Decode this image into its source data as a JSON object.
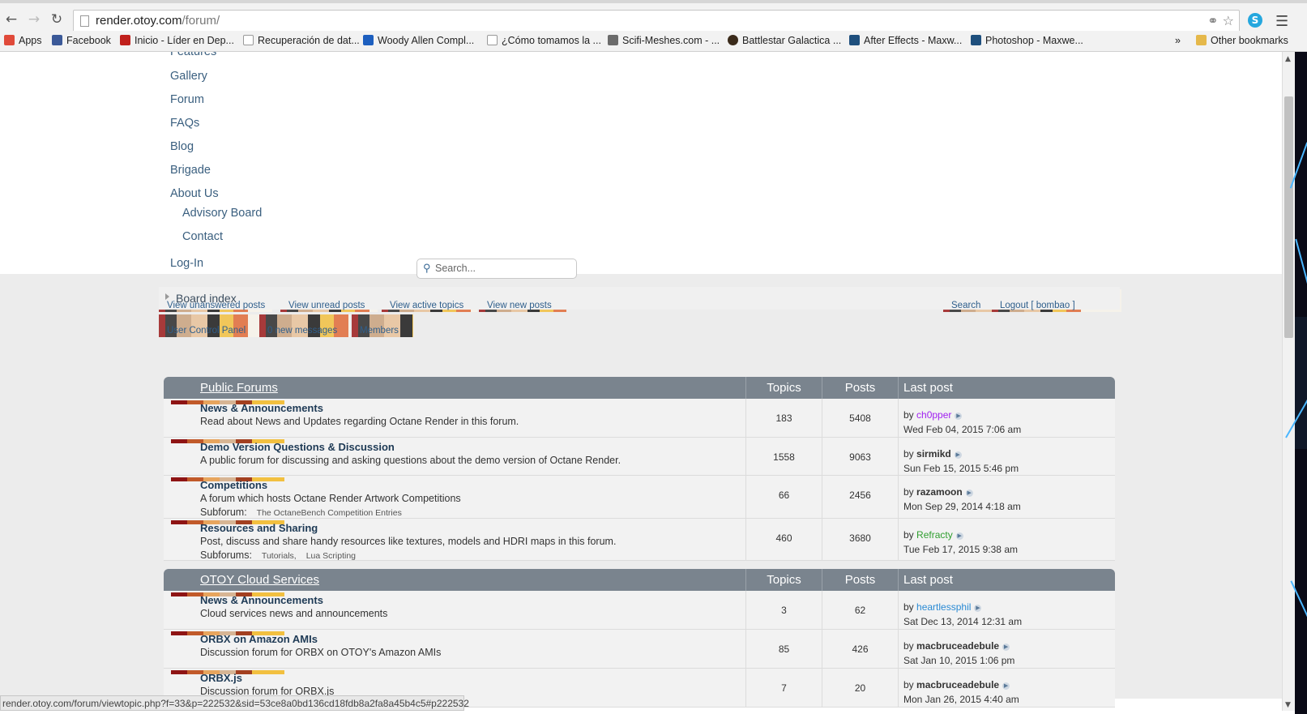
{
  "browser": {
    "url_host": "render.otoy.com",
    "url_path": "/forum/",
    "ext_icon": "S"
  },
  "bookmarks": [
    {
      "label": "Apps",
      "color": "#e04a3a"
    },
    {
      "label": "Facebook",
      "color": "#3b5998"
    },
    {
      "label": "Inicio - Líder en Dep...",
      "color": "#c0201c"
    },
    {
      "label": "Recuperación de dat...",
      "color": "#ffffff"
    },
    {
      "label": "Woody Allen Compl...",
      "color": "#1d5fbf"
    },
    {
      "label": "¿Cómo tomamos la ...",
      "color": "#ffffff"
    },
    {
      "label": "Scifi-Meshes.com - ...",
      "color": "#6b6b6b"
    },
    {
      "label": "Battlestar Galactica ...",
      "color": "#3a2a1a"
    },
    {
      "label": "After Effects - Maxw...",
      "color": "#1e4f7d"
    },
    {
      "label": "Photoshop - Maxwe...",
      "color": "#1e4f7d"
    },
    {
      "label": "»",
      "color": ""
    },
    {
      "label": "Other bookmarks",
      "color": "#e5b84a"
    }
  ],
  "site_menu": [
    {
      "label": "Features"
    },
    {
      "label": "Gallery"
    },
    {
      "label": "Forum"
    },
    {
      "label": "FAQs"
    },
    {
      "label": "Blog"
    },
    {
      "label": "Brigade"
    },
    {
      "label": "About Us"
    },
    {
      "label": "Advisory Board"
    },
    {
      "label": "Contact"
    },
    {
      "label": "Log-In"
    }
  ],
  "actions": {
    "unanswered": "View unanswered posts",
    "unread": "View unread posts",
    "active": "View active topics",
    "new": "View new posts",
    "search": "Search",
    "logout": "Logout [ bombao ]",
    "ucp": "User Control Panel",
    "messages": "0 new messages",
    "members": "Members",
    "search_placeholder": "Search..."
  },
  "breadcrumb": "Board index",
  "categories": [
    {
      "title": "Public Forums",
      "col_topics": "Topics",
      "col_posts": "Posts",
      "col_last": "Last post",
      "forums": [
        {
          "name": "News & Announcements",
          "desc": "Read about News and Updates regarding Octane Render in this forum.",
          "sub_label": "",
          "subs": [],
          "topics": "183",
          "posts": "5408",
          "by": "by",
          "user": "ch0pper",
          "user_color": "#a020f0",
          "bold": false,
          "time": "Wed Feb 04, 2015 7:06 am"
        },
        {
          "name": "Demo Version Questions & Discussion",
          "desc": "A public forum for discussing and asking questions about the demo version of Octane Render.",
          "sub_label": "",
          "subs": [],
          "topics": "1558",
          "posts": "9063",
          "by": "by",
          "user": "sirmikd",
          "user_color": "#333333",
          "bold": true,
          "time": "Sun Feb 15, 2015 5:46 pm"
        },
        {
          "name": "Competitions",
          "desc": "A forum which hosts Octane Render Artwork Competitions",
          "sub_label": "Subforum:",
          "subs": [
            "The OctaneBench Competition Entries"
          ],
          "topics": "66",
          "posts": "2456",
          "by": "by",
          "user": "razamoon",
          "user_color": "#333333",
          "bold": true,
          "time": "Mon Sep 29, 2014 4:18 am"
        },
        {
          "name": "Resources and Sharing",
          "desc": "Post, discuss and share handy resources like textures, models and HDRI maps in this forum.",
          "sub_label": "Subforums:",
          "subs": [
            "Tutorials,",
            "Lua Scripting"
          ],
          "topics": "460",
          "posts": "3680",
          "by": "by",
          "user": "Refracty",
          "user_color": "#2f9e2f",
          "bold": false,
          "time": "Tue Feb 17, 2015 9:38 am"
        }
      ]
    },
    {
      "title": "OTOY Cloud Services",
      "col_topics": "Topics",
      "col_posts": "Posts",
      "col_last": "Last post",
      "forums": [
        {
          "name": "News & Announcements",
          "desc": "Cloud services news and announcements",
          "sub_label": "",
          "subs": [],
          "topics": "3",
          "posts": "62",
          "by": "by",
          "user": "heartlessphil",
          "user_color": "#2a8ad4",
          "bold": false,
          "time": "Sat Dec 13, 2014 12:31 am"
        },
        {
          "name": "ORBX on Amazon AMIs",
          "desc": "Discussion forum for ORBX on OTOY's Amazon AMIs",
          "sub_label": "",
          "subs": [],
          "topics": "85",
          "posts": "426",
          "by": "by",
          "user": "macbruceadebule",
          "user_color": "#333333",
          "bold": true,
          "time": "Sat Jan 10, 2015 1:06 pm"
        },
        {
          "name": "ORBX.js",
          "desc": "Discussion forum for ORBX.js",
          "sub_label": "",
          "subs": [],
          "topics": "7",
          "posts": "20",
          "by": "by",
          "user": "macbruceadebule",
          "user_color": "#333333",
          "bold": true,
          "time": "Mon Jan 26, 2015 4:40 am"
        }
      ]
    }
  ],
  "status_url": "render.otoy.com/forum/viewtopic.php?f=33&p=222532&sid=53ce8a0bd136cd18fdb8a2fa8a45b4c5#p222532",
  "icons": {
    "back": "back-arrow-icon",
    "forward": "forward-arrow-icon",
    "reload": "reload-icon",
    "star": "star-icon",
    "key": "key-icon",
    "menu": "hamburger-menu-icon",
    "search": "magnifier-icon"
  }
}
